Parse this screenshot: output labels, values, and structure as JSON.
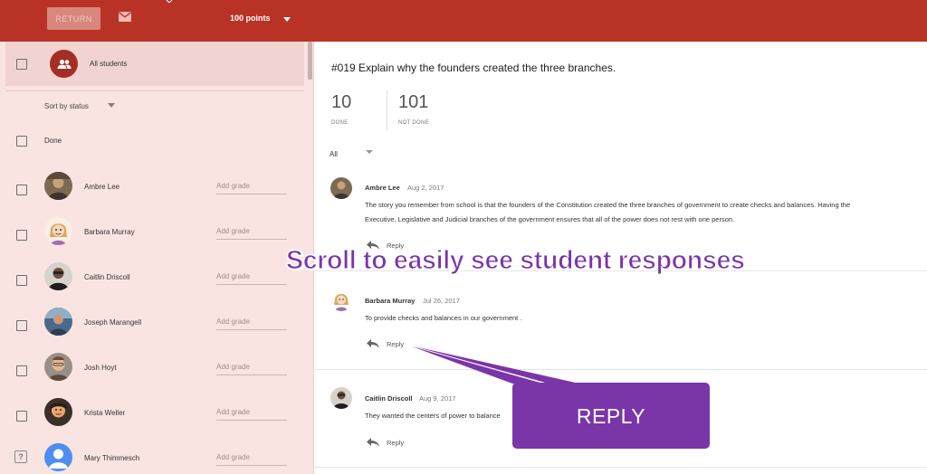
{
  "topbar": {
    "return_label": "RETURN",
    "points_label": "100 points",
    "mail_icon": "mail-icon",
    "brand_color": "#b83226"
  },
  "sidebar": {
    "all_students_label": "All students",
    "sort_label": "Sort by status",
    "done_group_label": "Done",
    "students": [
      {
        "name": "Ambre Lee",
        "grade_placeholder": "Add grade"
      },
      {
        "name": "Barbara Murray",
        "grade_placeholder": "Add grade"
      },
      {
        "name": "Caitlin Driscoll",
        "grade_placeholder": "Add grade"
      },
      {
        "name": "Joseph Marangell",
        "grade_placeholder": "Add grade"
      },
      {
        "name": "Josh Hoyt",
        "grade_placeholder": "Add grade"
      },
      {
        "name": "Krista Weller",
        "grade_placeholder": "Add grade"
      },
      {
        "name": "Mary Thimmesch",
        "grade_placeholder": "Add grade"
      }
    ],
    "background_color": "#fae4e2"
  },
  "main": {
    "question_title": "#019 Explain why the founders created the three branches.",
    "stats": {
      "done_count": "10",
      "done_label": "DONE",
      "not_done_count": "101",
      "not_done_label": "NOT DONE"
    },
    "filter_label": "All",
    "responses": [
      {
        "name": "Ambre Lee",
        "date": "Aug 2, 2017",
        "line1": "The story you remember from school is that the founders of the Constitution created the three branches of government to create checks and balances. Having the",
        "line2": "Executive, Legislative and Judicial branches of the government ensures that all of the power does not rest with one person.",
        "reply_label": "Reply"
      },
      {
        "name": "Barbara Murray",
        "date": "Jul 26, 2017",
        "line1": "To provide checks and balances in our government .",
        "reply_label": "Reply"
      },
      {
        "name": "Caitlin Driscoll",
        "date": "Aug 9, 2017",
        "line1": "They wanted the centers of power to balance",
        "reply_label": "Reply"
      }
    ]
  },
  "overlay": {
    "headline": "Scroll to easily see student responses",
    "callout_label": "REPLY",
    "accent_color": "#7a35a8"
  }
}
